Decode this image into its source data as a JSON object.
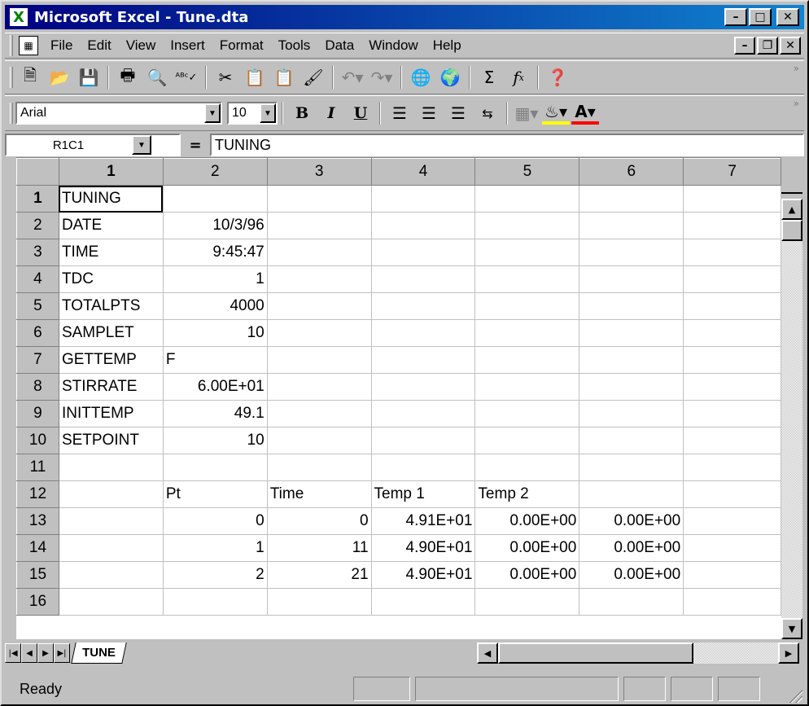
{
  "window": {
    "title": "Microsoft Excel - Tune.dta",
    "app_icon": "excel-x-logo"
  },
  "window_buttons": [
    "_",
    "□",
    "X"
  ],
  "menubar": {
    "items": [
      {
        "label": "File"
      },
      {
        "label": "Edit"
      },
      {
        "label": "View"
      },
      {
        "label": "Insert"
      },
      {
        "label": "Format"
      },
      {
        "label": "Tools"
      },
      {
        "label": "Data"
      },
      {
        "label": "Window"
      },
      {
        "label": "Help"
      }
    ]
  },
  "format_toolbar": {
    "font": "Arial",
    "size": "10",
    "bold": "B",
    "italic": "I",
    "underline": "U"
  },
  "formula_bar": {
    "cell_ref": "R1C1",
    "equals": "=",
    "value": "TUNING"
  },
  "columns": [
    "1",
    "2",
    "3",
    "4",
    "5",
    "6",
    "7"
  ],
  "rows": [
    {
      "n": "1",
      "cells": [
        "TUNING",
        "",
        "",
        "",
        "",
        "",
        ""
      ]
    },
    {
      "n": "2",
      "cells": [
        "DATE",
        "10/3/96",
        "",
        "",
        "",
        "",
        ""
      ]
    },
    {
      "n": "3",
      "cells": [
        "TIME",
        "9:45:47",
        "",
        "",
        "",
        "",
        ""
      ]
    },
    {
      "n": "4",
      "cells": [
        "TDC",
        "1",
        "",
        "",
        "",
        "",
        ""
      ]
    },
    {
      "n": "5",
      "cells": [
        "TOTALPTS",
        "4000",
        "",
        "",
        "",
        "",
        ""
      ]
    },
    {
      "n": "6",
      "cells": [
        "SAMPLET",
        "10",
        "",
        "",
        "",
        "",
        ""
      ]
    },
    {
      "n": "7",
      "cells": [
        "GETTEMP",
        "F",
        "",
        "",
        "",
        "",
        ""
      ]
    },
    {
      "n": "8",
      "cells": [
        "STIRRATE",
        "6.00E+01",
        "",
        "",
        "",
        "",
        ""
      ]
    },
    {
      "n": "9",
      "cells": [
        "INITTEMP",
        "49.1",
        "",
        "",
        "",
        "",
        ""
      ]
    },
    {
      "n": "10",
      "cells": [
        "SETPOINT",
        "10",
        "",
        "",
        "",
        "",
        ""
      ]
    },
    {
      "n": "11",
      "cells": [
        "",
        "",
        "",
        "",
        "",
        "",
        ""
      ]
    },
    {
      "n": "12",
      "cells": [
        "",
        "Pt",
        "Time",
        "Temp 1",
        "Temp 2",
        "",
        ""
      ]
    },
    {
      "n": "13",
      "cells": [
        "",
        "0",
        "0",
        "4.91E+01",
        "0.00E+00",
        "0.00E+00",
        ""
      ]
    },
    {
      "n": "14",
      "cells": [
        "",
        "1",
        "11",
        "4.90E+01",
        "0.00E+00",
        "0.00E+00",
        ""
      ]
    },
    {
      "n": "15",
      "cells": [
        "",
        "2",
        "21",
        "4.90E+01",
        "0.00E+00",
        "0.00E+00",
        ""
      ]
    },
    {
      "n": "16",
      "cells": [
        "",
        "",
        "",
        "",
        "",
        "",
        ""
      ]
    }
  ],
  "sheet_tab": "TUNE",
  "status": {
    "text": "Ready"
  }
}
